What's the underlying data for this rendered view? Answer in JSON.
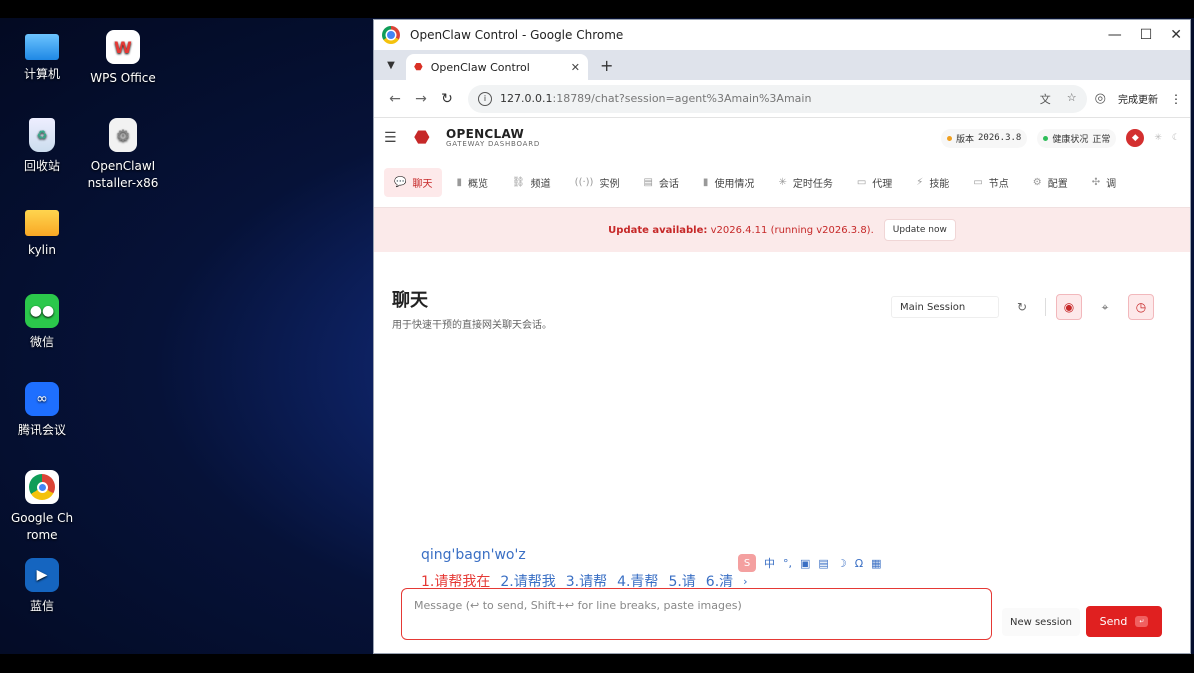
{
  "desktop": {
    "icons": [
      {
        "label": "计算机",
        "name": "computer-icon"
      },
      {
        "label": "WPS Office",
        "name": "wps-office-icon"
      },
      {
        "label": "回收站",
        "name": "recycle-bin-icon"
      },
      {
        "label": "OpenClawInstaller-x86",
        "name": "installer-icon"
      },
      {
        "label": "kylin",
        "name": "folder-icon"
      },
      {
        "label": "微信",
        "name": "wechat-icon"
      },
      {
        "label": "腾讯会议",
        "name": "tencent-meeting-icon"
      },
      {
        "label": "Google Chrome",
        "name": "chrome-icon"
      },
      {
        "label": "蓝信",
        "name": "lanxin-icon"
      }
    ]
  },
  "window": {
    "title": "OpenClaw Control - Google Chrome",
    "controls": {
      "minimize": "—",
      "maximize": "☐",
      "close": "✕"
    }
  },
  "tabs": [
    {
      "label": "OpenClaw Control"
    }
  ],
  "address": {
    "host": "127.0.0.1",
    "rest": ":18789/chat?session=agent%3Amain%3Amain",
    "update_label": "完成更新"
  },
  "app": {
    "brand": {
      "name": "OPENCLAW",
      "sub": "GATEWAY DASHBOARD"
    },
    "version_label": "版本",
    "version_value": "2026.3.8",
    "health_label": "健康状况",
    "health_value": "正常",
    "nav": [
      {
        "label": "聊天",
        "icon": "chat-icon",
        "glyph": "💬"
      },
      {
        "label": "概览",
        "icon": "overview-icon",
        "glyph": "▮"
      },
      {
        "label": "频道",
        "icon": "channel-icon",
        "glyph": "⛓"
      },
      {
        "label": "实例",
        "icon": "instance-icon",
        "glyph": "((·))"
      },
      {
        "label": "会话",
        "icon": "session-icon",
        "glyph": "▤"
      },
      {
        "label": "使用情况",
        "icon": "usage-icon",
        "glyph": "▮"
      },
      {
        "label": "定时任务",
        "icon": "cron-icon",
        "glyph": "✳"
      },
      {
        "label": "代理",
        "icon": "agent-folder-icon",
        "glyph": "▭"
      },
      {
        "label": "技能",
        "icon": "skills-icon",
        "glyph": "⚡"
      },
      {
        "label": "节点",
        "icon": "nodes-icon",
        "glyph": "▭"
      },
      {
        "label": "配置",
        "icon": "config-icon",
        "glyph": "⚙"
      },
      {
        "label": "调",
        "icon": "debug-icon",
        "glyph": "✣"
      }
    ],
    "banner": {
      "title": "Update available:",
      "detail": "v2026.4.11 (running v2026.3.8).",
      "button": "Update now"
    },
    "page": {
      "title": "聊天",
      "subtitle": "用于快速干预的直接网关聊天会话。"
    },
    "session_select": "Main Session",
    "ime": {
      "pinyin": "qing'bagn'wo'z",
      "candidates": [
        "1.请帮我在",
        "2.请帮我",
        "3.请帮",
        "4.青帮",
        "5.请",
        "6.清"
      ],
      "tool_mode": "中"
    },
    "composer": {
      "placeholder": "Message (↩ to send, Shift+↩ for line breaks, paste images)"
    },
    "new_session": "New session",
    "send": {
      "label": "Send",
      "kbd": "↵"
    }
  }
}
